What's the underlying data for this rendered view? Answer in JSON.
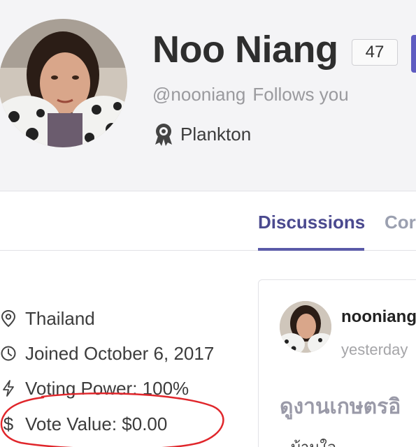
{
  "profile": {
    "display_name": "Noo Niang",
    "reputation": "47",
    "handle": "@nooniang",
    "follows_status": "Follows you",
    "rank": "Plankton",
    "rank_icon": "award-medal-icon"
  },
  "tabs": [
    {
      "label": "Discussions",
      "active": true
    },
    {
      "label": "Cor",
      "active": false
    }
  ],
  "info": {
    "location": "Thailand",
    "joined": "Joined October 6, 2017",
    "voting_power": "Voting Power: 100%",
    "vote_value": "Vote Value: $0.00",
    "vote_value_symbol": "$"
  },
  "post": {
    "author": "nooniang",
    "time": "yesterday",
    "title": "ดูงานเกษตรอิ",
    "snippet": "บ้านใจ ..."
  },
  "colors": {
    "accent": "#5f5cc1",
    "tab_active": "#4b4a8f",
    "annotation": "#e0262b"
  }
}
